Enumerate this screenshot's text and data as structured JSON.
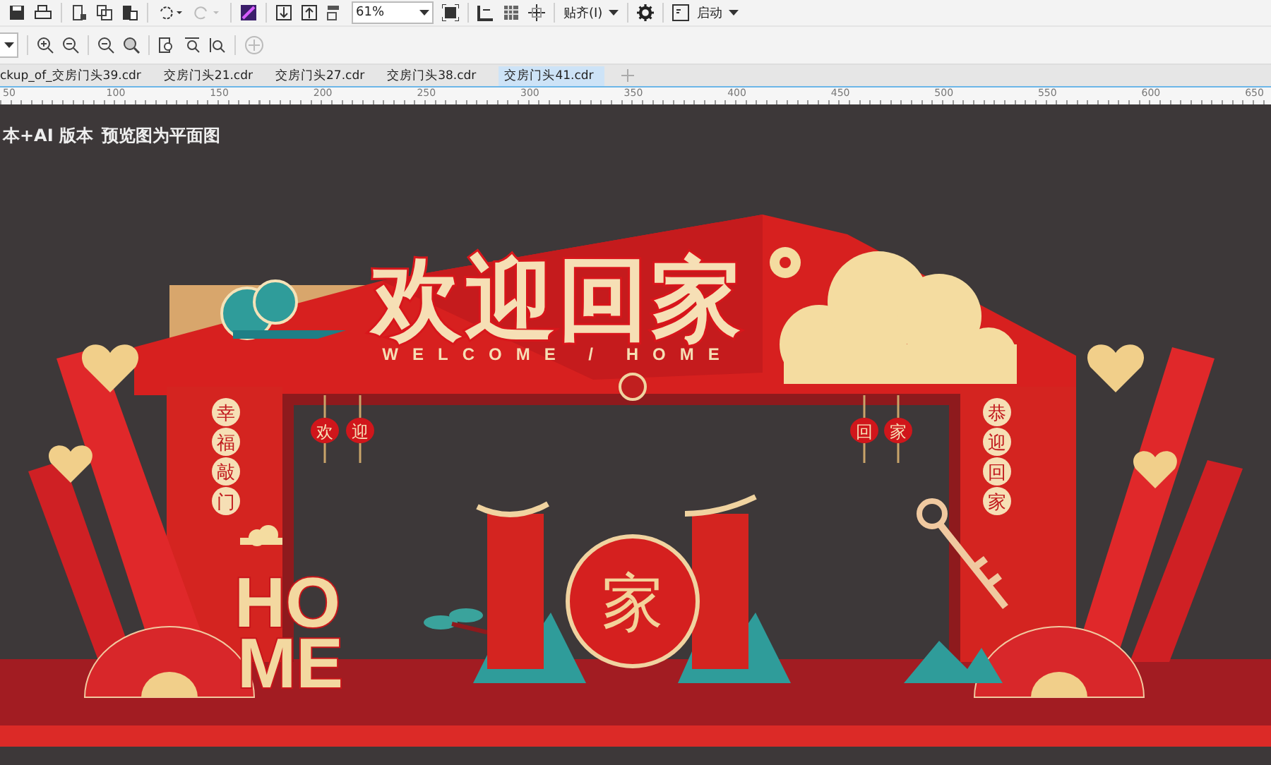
{
  "toolbar": {
    "zoom_value": "61%",
    "snap_label": "贴齐(I)",
    "launch_label": "启动"
  },
  "tabs": [
    {
      "label": "ckup_of_交房门头39.cdr",
      "selected": false
    },
    {
      "label": "交房门头21.cdr",
      "selected": false
    },
    {
      "label": "交房门头27.cdr",
      "selected": false
    },
    {
      "label": "交房门头38.cdr",
      "selected": false
    },
    {
      "label": "交房门头41.cdr",
      "selected": true
    }
  ],
  "ruler": {
    "labels": [
      "50",
      "100",
      "150",
      "200",
      "250",
      "300",
      "350",
      "400",
      "450",
      "500",
      "550",
      "600",
      "650"
    ]
  },
  "canvas": {
    "notes": [
      "本+AI 版本",
      "预览图为平面图"
    ],
    "artwork": {
      "title": "欢迎回家",
      "subtitle": "WELCOME / HOME",
      "left_banner": "幸福敲门",
      "right_banner": "恭迎回家",
      "lanterns": [
        "欢",
        "迎",
        "回",
        "家"
      ],
      "home_top": "HO",
      "home_bottom": "ME",
      "center_character": "家"
    }
  }
}
